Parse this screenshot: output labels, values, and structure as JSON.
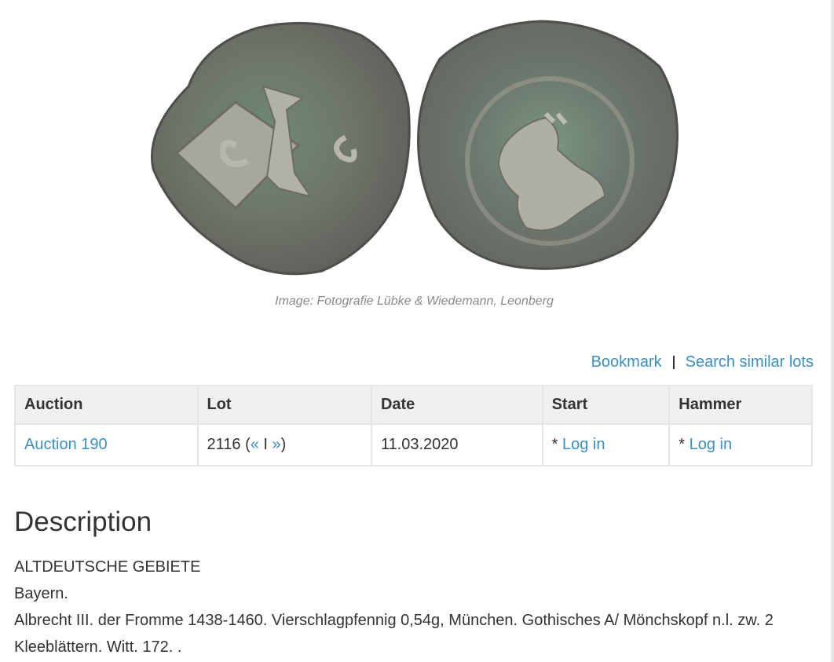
{
  "image": {
    "alt": "",
    "caption": "Image: Fotografie Lübke & Wiedemann, Leonberg"
  },
  "actions": {
    "bookmark": "Bookmark",
    "search_similar": "Search similar lots"
  },
  "table": {
    "headers": [
      "Auction",
      "Lot",
      "Date",
      "Start",
      "Hammer"
    ],
    "row": {
      "auction": "Auction 190",
      "lot_number": "2116",
      "lot_prev": "«",
      "lot_sep": "I",
      "lot_next": "»",
      "date": "11.03.2020",
      "start_prefix": "*",
      "start_link": "Log in",
      "hammer_prefix": "*",
      "hammer_link": "Log in"
    }
  },
  "description": {
    "title": "Description",
    "lines": [
      "ALTDEUTSCHE GEBIETE",
      "Bayern.",
      "Albrecht III. der Fromme 1438-1460. Vierschlagpfennig 0,54g, München. Gothisches A/ Mönchskopf n.l. zw. 2 Kleeblättern. Witt. 172. ."
    ]
  },
  "colors": {
    "link": "#3a8fc4",
    "header_bg": "#f0f0f0",
    "border": "#e5e5e5",
    "text": "#333333",
    "caption": "#8a8a8a"
  }
}
